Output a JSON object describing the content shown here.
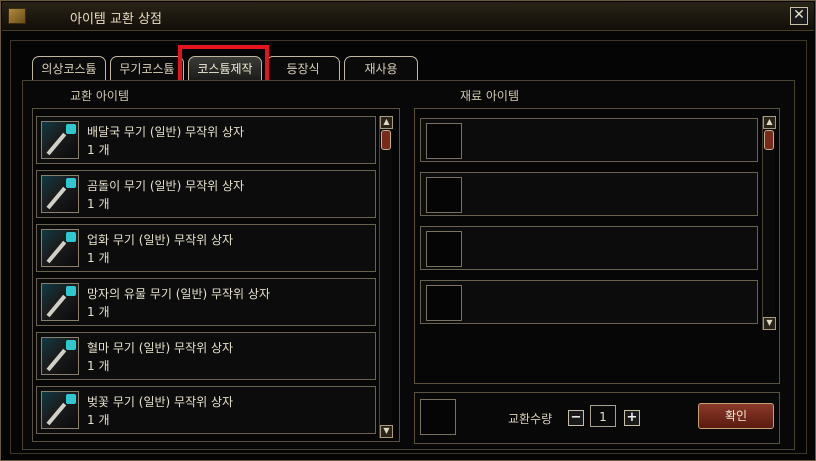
{
  "window": {
    "title": "아이템 교환 상점",
    "close_symbol": "✕"
  },
  "tabs": [
    {
      "label": "의상코스튬",
      "active": false
    },
    {
      "label": "무기코스튬",
      "active": false
    },
    {
      "label": "코스튬제작",
      "active": true
    },
    {
      "label": "등장식",
      "active": false
    },
    {
      "label": "재사용",
      "active": false
    }
  ],
  "exchange": {
    "header": "교환 아이템",
    "items": [
      {
        "name": "배달국 무기 (일반) 무작위 상자",
        "qty": "1 개"
      },
      {
        "name": "곰돌이 무기 (일반) 무작위 상자",
        "qty": "1 개"
      },
      {
        "name": "업화 무기 (일반) 무작위 상자",
        "qty": "1 개"
      },
      {
        "name": "망자의 유물 무기 (일반) 무작위 상자",
        "qty": "1 개"
      },
      {
        "name": "혈마 무기 (일반) 무작위 상자",
        "qty": "1 개"
      },
      {
        "name": "벚꽃 무기 (일반) 무작위 상자",
        "qty": "1 개"
      }
    ]
  },
  "materials": {
    "header": "재료 아이템",
    "slots": 4
  },
  "footer": {
    "qty_label": "교환수량",
    "minus_symbol": "−",
    "plus_symbol": "+",
    "qty_value": "1",
    "confirm_label": "확인"
  },
  "colors": {
    "highlight": "#e3141b",
    "accent_gem": "#30c8d0",
    "confirm_bg": "#7a2a1a"
  },
  "icons": [
    "close-icon",
    "scroll-up-icon",
    "scroll-down-icon",
    "weapon-icon",
    "gem-icon"
  ]
}
